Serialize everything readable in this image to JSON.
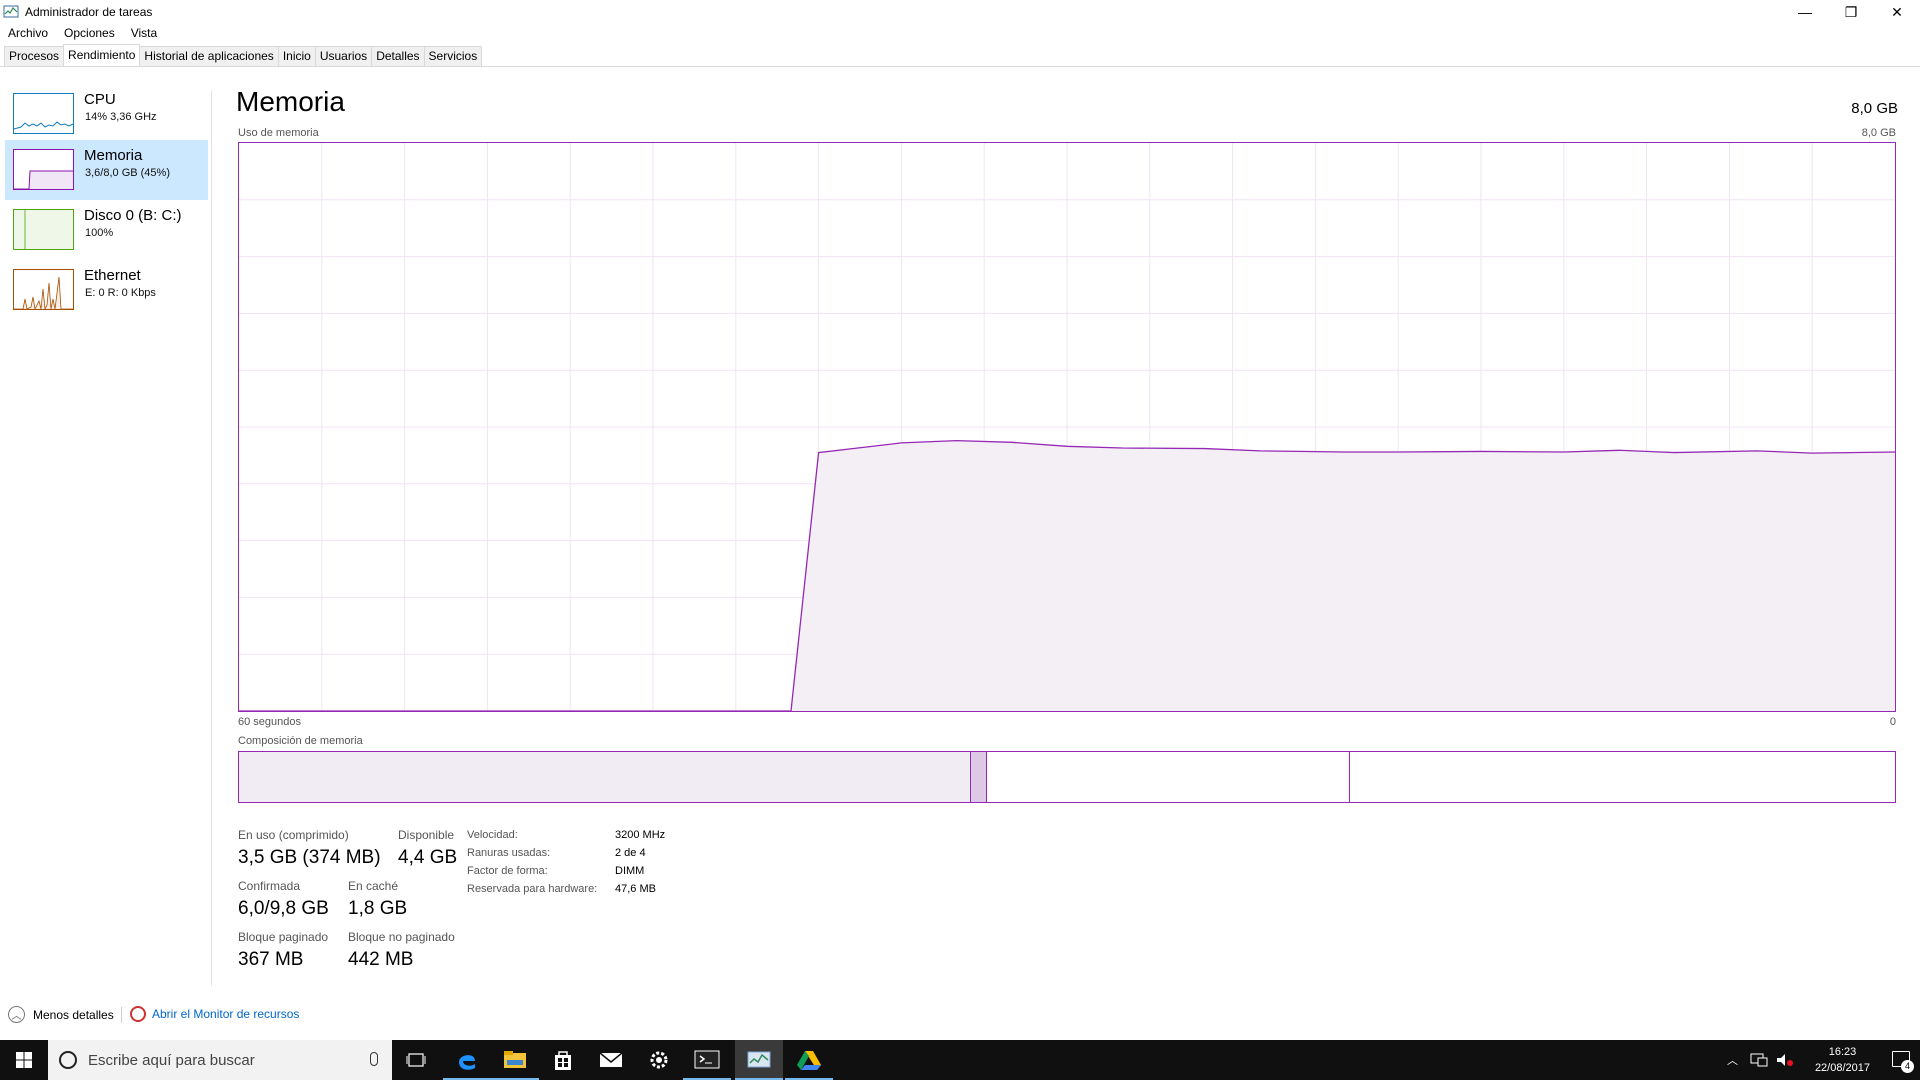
{
  "window": {
    "title": "Administrador de tareas",
    "buttons": [
      "—",
      "❐",
      "✕"
    ]
  },
  "menu": [
    "Archivo",
    "Opciones",
    "Vista"
  ],
  "tabs": [
    "Procesos",
    "Rendimiento",
    "Historial de aplicaciones",
    "Inicio",
    "Usuarios",
    "Detalles",
    "Servicios"
  ],
  "active_tab": "Rendimiento",
  "sidebar": {
    "items": [
      {
        "label": "CPU",
        "sub": "14%  3,36 GHz",
        "color": "#117dbb"
      },
      {
        "label": "Memoria",
        "sub": "3,6/8,0 GB (45%)",
        "color": "#8b12ae",
        "selected": true
      },
      {
        "label": "Disco 0 (B: C:)",
        "sub": "100%",
        "color": "#4da60c"
      },
      {
        "label": "Ethernet",
        "sub": "E: 0  R: 0 Kbps",
        "color": "#a74f01"
      }
    ]
  },
  "main": {
    "title": "Memoria",
    "total": "8,0 GB",
    "graph_label": "Uso de memoria",
    "graph_max": "8,0 GB",
    "time_left": "60 segundos",
    "time_right": "0",
    "composition_label": "Composición de memoria",
    "accent": "#9528b4",
    "fill": "#f3eff5",
    "stats": {
      "in_use_label": "En uso (comprimido)",
      "in_use_value": "3,5 GB (374 MB)",
      "available_label": "Disponible",
      "available_value": "4,4 GB",
      "committed_label": "Confirmada",
      "committed_value": "6,0/9,8 GB",
      "cached_label": "En caché",
      "cached_value": "1,8 GB",
      "paged_label": "Bloque paginado",
      "paged_value": "367 MB",
      "nonpaged_label": "Bloque no paginado",
      "nonpaged_value": "442 MB"
    },
    "info": [
      {
        "label": "Velocidad:",
        "value": "3200 MHz"
      },
      {
        "label": "Ranuras usadas:",
        "value": "2 de 4"
      },
      {
        "label": "Factor de forma:",
        "value": "DIMM"
      },
      {
        "label": "Reservada para hardware:",
        "value": "47,6 MB"
      }
    ]
  },
  "usage_series": {
    "x_seconds_ago": [
      60,
      40,
      39,
      36,
      34,
      32,
      30,
      28,
      25,
      23,
      20,
      18,
      15,
      12,
      10,
      8,
      5,
      3,
      0
    ],
    "percent": [
      0,
      0,
      45.5,
      47.2,
      47.6,
      47.3,
      46.6,
      46.3,
      46.2,
      45.8,
      45.6,
      45.6,
      45.7,
      45.6,
      45.9,
      45.5,
      45.8,
      45.4,
      45.6
    ]
  },
  "composition": {
    "in_use_fraction": 0.442,
    "modified_fraction": 0.01,
    "standby_fraction": 0.219,
    "free_fraction": 0.329
  },
  "footer": {
    "less_details": "Menos detalles",
    "resource_monitor": "Abrir el Monitor de recursos"
  },
  "taskbar": {
    "search_placeholder": "Escribe aquí para buscar",
    "time": "16:23",
    "date": "22/08/2017",
    "notifications": "4"
  }
}
